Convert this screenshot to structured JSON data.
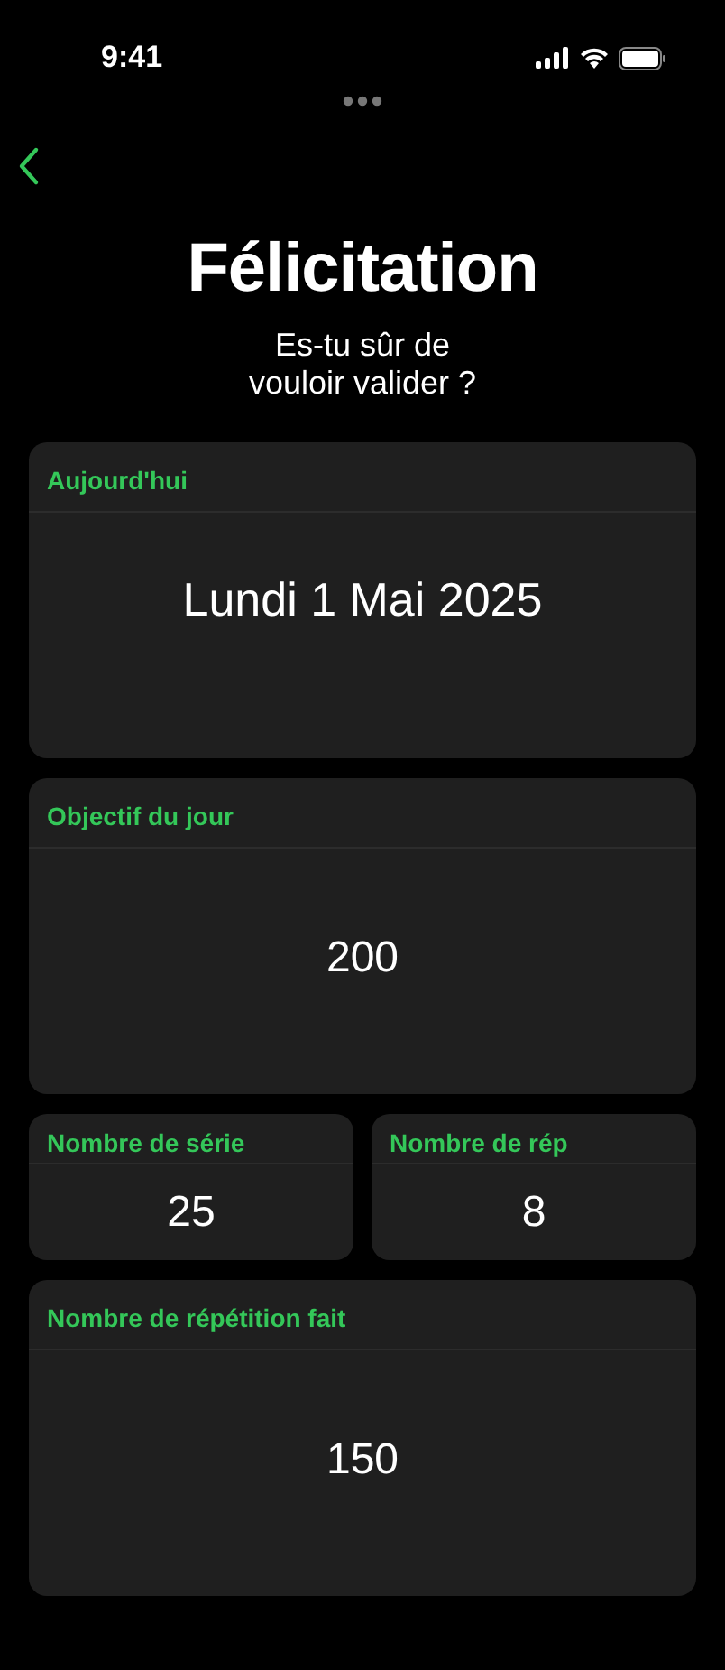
{
  "status_bar": {
    "time": "9:41"
  },
  "title": "Félicitation",
  "subtitle": "Es-tu sûr de\n  vouloir valider ?",
  "cards": [
    {
      "kind": "wide",
      "label": "Aujourd'hui",
      "value": "Lundi 1 Mai 2025"
    },
    {
      "kind": "wide",
      "label": "Objectif du jour",
      "value": "200"
    },
    {
      "kind": "half",
      "label": "Nombre de série",
      "value": "25"
    },
    {
      "kind": "half",
      "label": "Nombre de rép",
      "value": "8"
    },
    {
      "kind": "wide",
      "label": "Nombre de répétition fait",
      "value": "150"
    }
  ]
}
